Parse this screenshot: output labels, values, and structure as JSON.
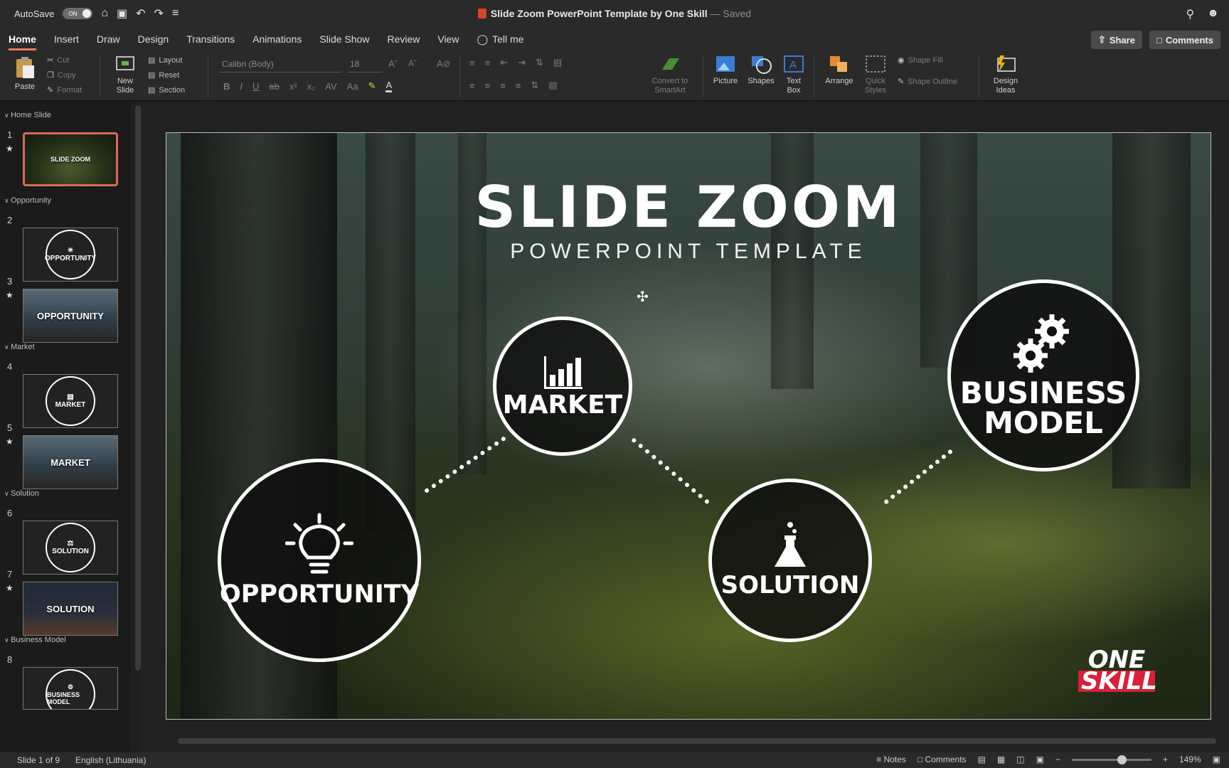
{
  "titlebar": {
    "autosave_label": "AutoSave",
    "autosave_state": "ON",
    "doc_title": "Slide Zoom PowerPoint Template by One Skill",
    "saved_status": "— Saved"
  },
  "tabs": [
    "Home",
    "Insert",
    "Draw",
    "Design",
    "Transitions",
    "Animations",
    "Slide Show",
    "Review",
    "View"
  ],
  "tell_me": "Tell me",
  "share": "Share",
  "comments": "Comments",
  "ribbon": {
    "paste": "Paste",
    "cut": "Cut",
    "copy": "Copy",
    "format": "Format",
    "new_slide_1": "New",
    "new_slide_2": "Slide",
    "layout": "Layout",
    "reset": "Reset",
    "section": "Section",
    "font": "Calibri (Body)",
    "font_size": "18",
    "convert_1": "Convert to",
    "convert_2": "SmartArt",
    "picture": "Picture",
    "shapes": "Shapes",
    "textbox_1": "Text",
    "textbox_2": "Box",
    "arrange": "Arrange",
    "quick_1": "Quick",
    "quick_2": "Styles",
    "shape_fill": "Shape Fill",
    "shape_outline": "Shape Outline",
    "design_1": "Design",
    "design_2": "Ideas"
  },
  "sidebar": {
    "sections": [
      "Home Slide",
      "Opportunity",
      "Market",
      "Solution",
      "Business Model"
    ],
    "slides": [
      {
        "num": "1",
        "label": "SLIDE ZOOM"
      },
      {
        "num": "2",
        "label": "OPPORTUNITY"
      },
      {
        "num": "3",
        "label": "OPPORTUNITY"
      },
      {
        "num": "4",
        "label": "MARKET"
      },
      {
        "num": "5",
        "label": "MARKET"
      },
      {
        "num": "6",
        "label": "SOLUTION"
      },
      {
        "num": "7",
        "label": "SOLUTION"
      },
      {
        "num": "8",
        "label": "BUSINESS MODEL"
      }
    ]
  },
  "slide": {
    "title": "SLIDE ZOOM",
    "subtitle": "POWERPOINT TEMPLATE",
    "zooms": {
      "market": "MARKET",
      "opportunity": "OPPORTUNITY",
      "solution": "SOLUTION",
      "business_1": "BUSINESS",
      "business_2": "MODEL"
    },
    "logo_1": "ONE",
    "logo_2": "SKILL"
  },
  "status": {
    "slide_of": "Slide 1 of 9",
    "language": "English (Lithuania)",
    "notes": "Notes",
    "comments": "Comments",
    "zoom": "149%"
  },
  "colors": {
    "accent": "#e87d66",
    "selection": "#e0685a",
    "logo_red": "#d8203a"
  }
}
